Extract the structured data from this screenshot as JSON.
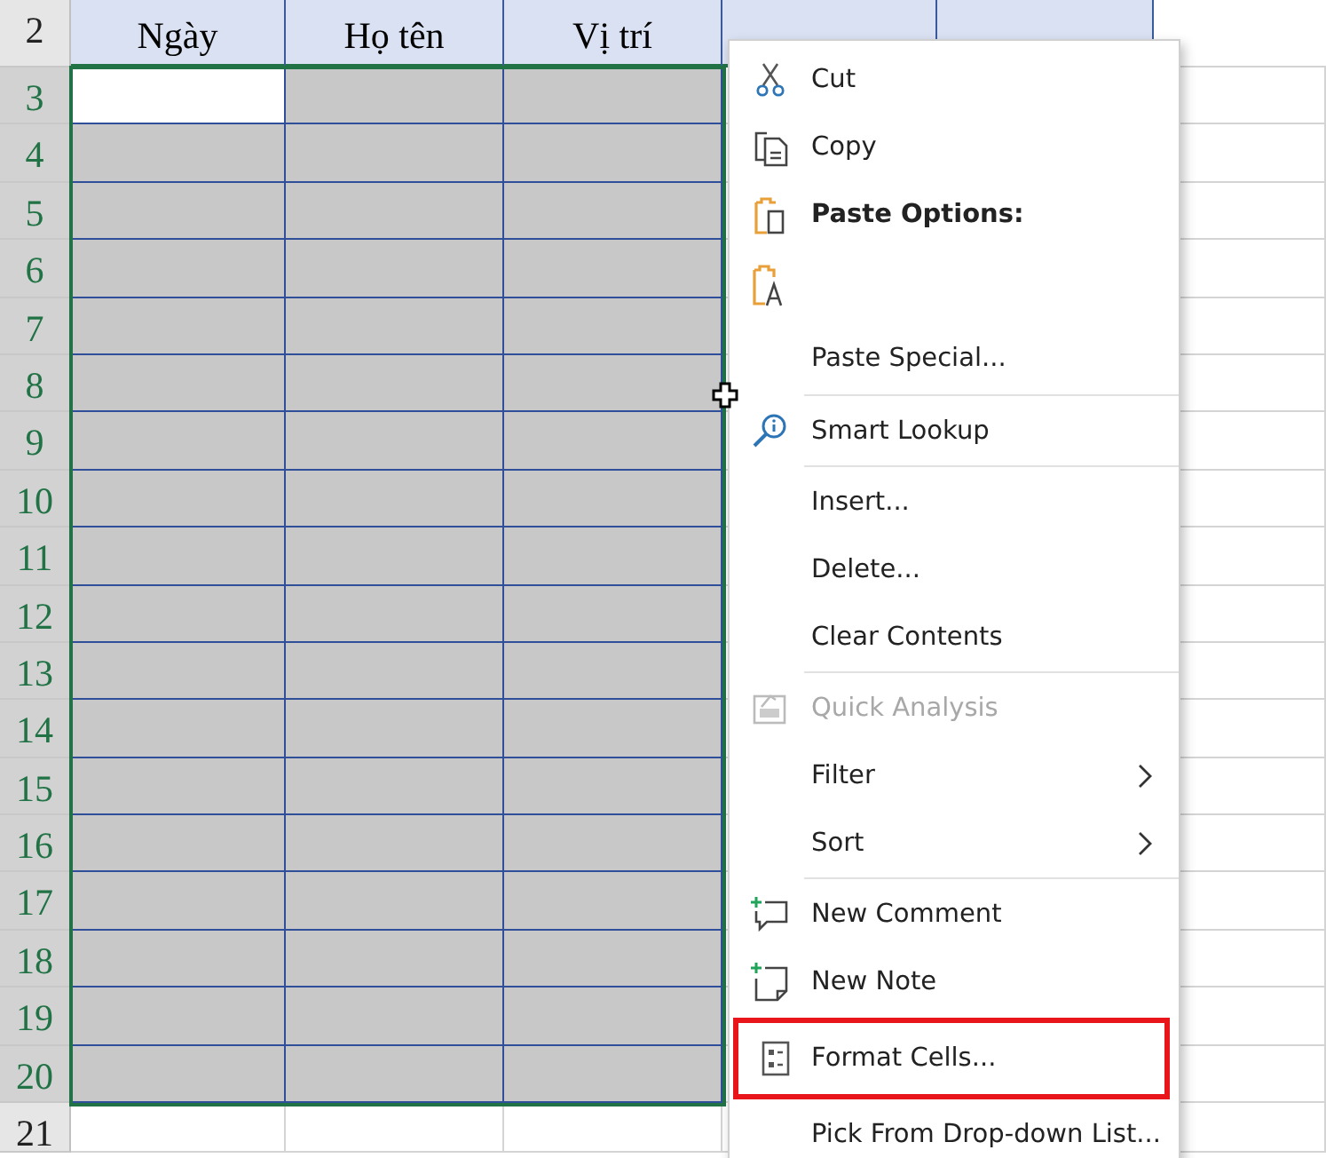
{
  "sheet": {
    "columns": [
      {
        "header": "Ngày"
      },
      {
        "header": "Họ tên"
      },
      {
        "header": "Vị trí"
      },
      {},
      {},
      {}
    ],
    "header_row": "2",
    "rows": [
      {
        "number": "3",
        "selected": true,
        "active": true
      },
      {
        "number": "4",
        "selected": true,
        "active": false
      },
      {
        "number": "5",
        "selected": true,
        "active": false
      },
      {
        "number": "6",
        "selected": true,
        "active": false
      },
      {
        "number": "7",
        "selected": true,
        "active": false
      },
      {
        "number": "8",
        "selected": true,
        "active": false
      },
      {
        "number": "9",
        "selected": true,
        "active": false
      },
      {
        "number": "10",
        "selected": true,
        "active": false
      },
      {
        "number": "11",
        "selected": true,
        "active": false
      },
      {
        "number": "12",
        "selected": true,
        "active": false
      },
      {
        "number": "13",
        "selected": true,
        "active": false
      },
      {
        "number": "14",
        "selected": true,
        "active": false
      },
      {
        "number": "15",
        "selected": true,
        "active": false
      },
      {
        "number": "16",
        "selected": true,
        "active": false
      },
      {
        "number": "17",
        "selected": true,
        "active": false
      },
      {
        "number": "18",
        "selected": true,
        "active": false
      },
      {
        "number": "19",
        "selected": true,
        "active": false
      },
      {
        "number": "20",
        "selected": true,
        "active": false
      },
      {
        "number": "21",
        "selected": false,
        "active": false
      }
    ]
  },
  "context_menu": {
    "items": [
      {
        "kind": "item",
        "label": "Cut",
        "disabled": false,
        "submenu": false,
        "highlighted": false
      },
      {
        "kind": "item",
        "label": "Copy",
        "disabled": false,
        "submenu": false,
        "highlighted": false
      },
      {
        "kind": "header",
        "label": "Paste Options:"
      },
      {
        "kind": "paste-option"
      },
      {
        "kind": "item",
        "label": "Paste Special...",
        "disabled": false,
        "submenu": false,
        "highlighted": false
      },
      {
        "kind": "separator"
      },
      {
        "kind": "item",
        "label": "Smart Lookup",
        "disabled": false,
        "submenu": false,
        "highlighted": false
      },
      {
        "kind": "separator"
      },
      {
        "kind": "item",
        "label": "Insert...",
        "disabled": false,
        "submenu": false,
        "highlighted": false
      },
      {
        "kind": "item",
        "label": "Delete...",
        "disabled": false,
        "submenu": false,
        "highlighted": false
      },
      {
        "kind": "item",
        "label": "Clear Contents",
        "disabled": false,
        "submenu": false,
        "highlighted": false
      },
      {
        "kind": "separator"
      },
      {
        "kind": "item",
        "label": "Quick Analysis",
        "disabled": true,
        "submenu": false,
        "highlighted": false
      },
      {
        "kind": "item",
        "label": "Filter",
        "disabled": false,
        "submenu": true,
        "highlighted": false
      },
      {
        "kind": "item",
        "label": "Sort",
        "disabled": false,
        "submenu": true,
        "highlighted": false
      },
      {
        "kind": "separator"
      },
      {
        "kind": "item",
        "label": "New Comment",
        "disabled": false,
        "submenu": false,
        "highlighted": false
      },
      {
        "kind": "item",
        "label": "New Note",
        "disabled": false,
        "submenu": false,
        "highlighted": false
      },
      {
        "kind": "item",
        "label": "Format Cells...",
        "disabled": false,
        "submenu": false,
        "highlighted": true
      },
      {
        "kind": "item",
        "label": "Pick From Drop-down List...",
        "disabled": false,
        "submenu": false,
        "highlighted": false
      }
    ]
  }
}
